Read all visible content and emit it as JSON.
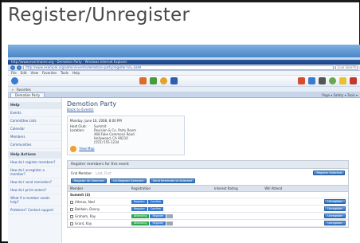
{
  "slide": {
    "title": "Register/Unregister"
  },
  "browser": {
    "title_bar": "http://www.eventname.org - Demotion Party - Windows Internet Explorer",
    "address": "http://www.example.org/admin/events/demotion-party/register?id=1049",
    "search_placeholder": "Live Search",
    "menu": [
      "File",
      "Edit",
      "View",
      "Favorites",
      "Tools",
      "Help"
    ],
    "favorites_label": "Favorites",
    "tab_label": "Demotion Party",
    "tab_tools": "Page ▾  Safety ▾  Tools ▾"
  },
  "sidebar": {
    "sections": [
      {
        "heading": "Help",
        "items": [
          "Events",
          "Committee Lists",
          "Calendar",
          "Members",
          "Communities"
        ]
      },
      {
        "heading": "Help Actions",
        "items": [
          "How do I register members?",
          "How do I unregister a member?",
          "How do I send reminders?",
          "How do I print rosters?",
          "What if a member needs help?",
          "Problems? Contact support"
        ]
      }
    ]
  },
  "main": {
    "page_title": "Demotion Party",
    "page_sub": "Back to Events",
    "info_heading": "Monday, June 16, 2008, 8:00 PM",
    "info_rows": [
      {
        "k": "Host Club:",
        "v": "Summit"
      },
      {
        "k": "Location:",
        "v": "Revision & Co. Party Room"
      },
      {
        "k": "",
        "v": "468 Fake Commons Road"
      },
      {
        "k": "",
        "v": "Hollywood, CA 90210"
      },
      {
        "k": "",
        "v": "(555) 555-1234"
      }
    ],
    "map_link": "View Map",
    "panel_heading": "Register members for this event",
    "filter_label": "Find Member:",
    "filter_value": "Last, First",
    "register_selected": "Register Selected",
    "buttons": [
      "Register All Selected",
      "Un-Register Selected",
      "Send Reminder to Selected"
    ],
    "columns": [
      "Member",
      "Registration",
      "Interest Rating",
      "Will Attend",
      ""
    ],
    "section_label": "Summit (4)",
    "rows": [
      {
        "name": "Altman, Ned",
        "status": "Register",
        "status2": "Confirm",
        "action": "Unregister"
      },
      {
        "name": "Baldwin, Danny",
        "status": "Register",
        "status2": "Confirm",
        "action": "Unregister"
      },
      {
        "name": "Graham, Ray",
        "status": "Attending",
        "status2": "Register",
        "action": "Unregister"
      },
      {
        "name": "Grant, Kay",
        "status": "Attending",
        "status2": "Register",
        "action": "Unregister"
      }
    ]
  },
  "colors": {
    "band": "#4a86c7",
    "title_text": "#4a4a4a",
    "accent_blue": "#3a7bd0",
    "accent_green": "#2fa84c"
  },
  "icons": [
    "back-icon",
    "forward-icon",
    "refresh-icon",
    "home-icon",
    "feed-icon",
    "print-icon",
    "favorites-star-icon",
    "map-pin-icon"
  ]
}
